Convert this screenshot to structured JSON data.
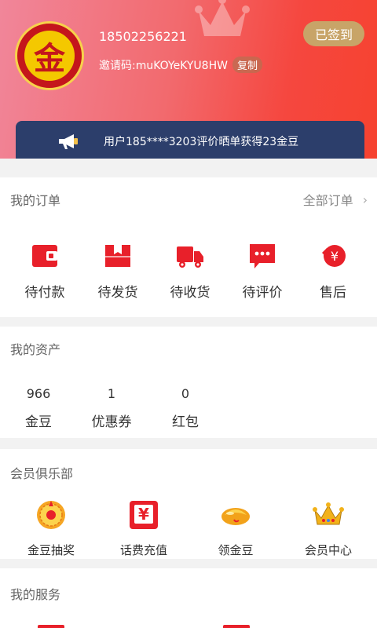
{
  "header": {
    "phone": "18502256221",
    "invite_label": "邀请码:muKOYeKYU8HW",
    "copy_label": "复制",
    "signin_label": "已签到",
    "avatar_char": "金"
  },
  "notice": {
    "text": "用户185****3203评价晒单获得23金豆"
  },
  "orders": {
    "title": "我的订单",
    "all_label": "全部订单",
    "items": [
      {
        "label": "待付款",
        "icon": "wallet-icon"
      },
      {
        "label": "待发货",
        "icon": "package-icon"
      },
      {
        "label": "待收货",
        "icon": "truck-icon"
      },
      {
        "label": "待评价",
        "icon": "comment-icon"
      },
      {
        "label": "售后",
        "icon": "refund-icon"
      }
    ]
  },
  "assets": {
    "title": "我的资产",
    "items": [
      {
        "value": "966",
        "label": "金豆"
      },
      {
        "value": "1",
        "label": "优惠券"
      },
      {
        "value": "0",
        "label": "红包"
      }
    ]
  },
  "club": {
    "title": "会员俱乐部",
    "items": [
      {
        "label": "金豆抽奖",
        "icon": "lottery-wheel-icon"
      },
      {
        "label": "话费充值",
        "icon": "phone-recharge-icon"
      },
      {
        "label": "领金豆",
        "icon": "gold-bean-icon"
      },
      {
        "label": "会员中心",
        "icon": "crown-icon"
      }
    ]
  },
  "services": {
    "title": "我的服务"
  },
  "colors": {
    "header_start": "#f1869a",
    "header_end": "#f6422f",
    "accent_red": "#e8202a",
    "gold": "#c8a468",
    "notice_bg": "#2c3e6b"
  }
}
